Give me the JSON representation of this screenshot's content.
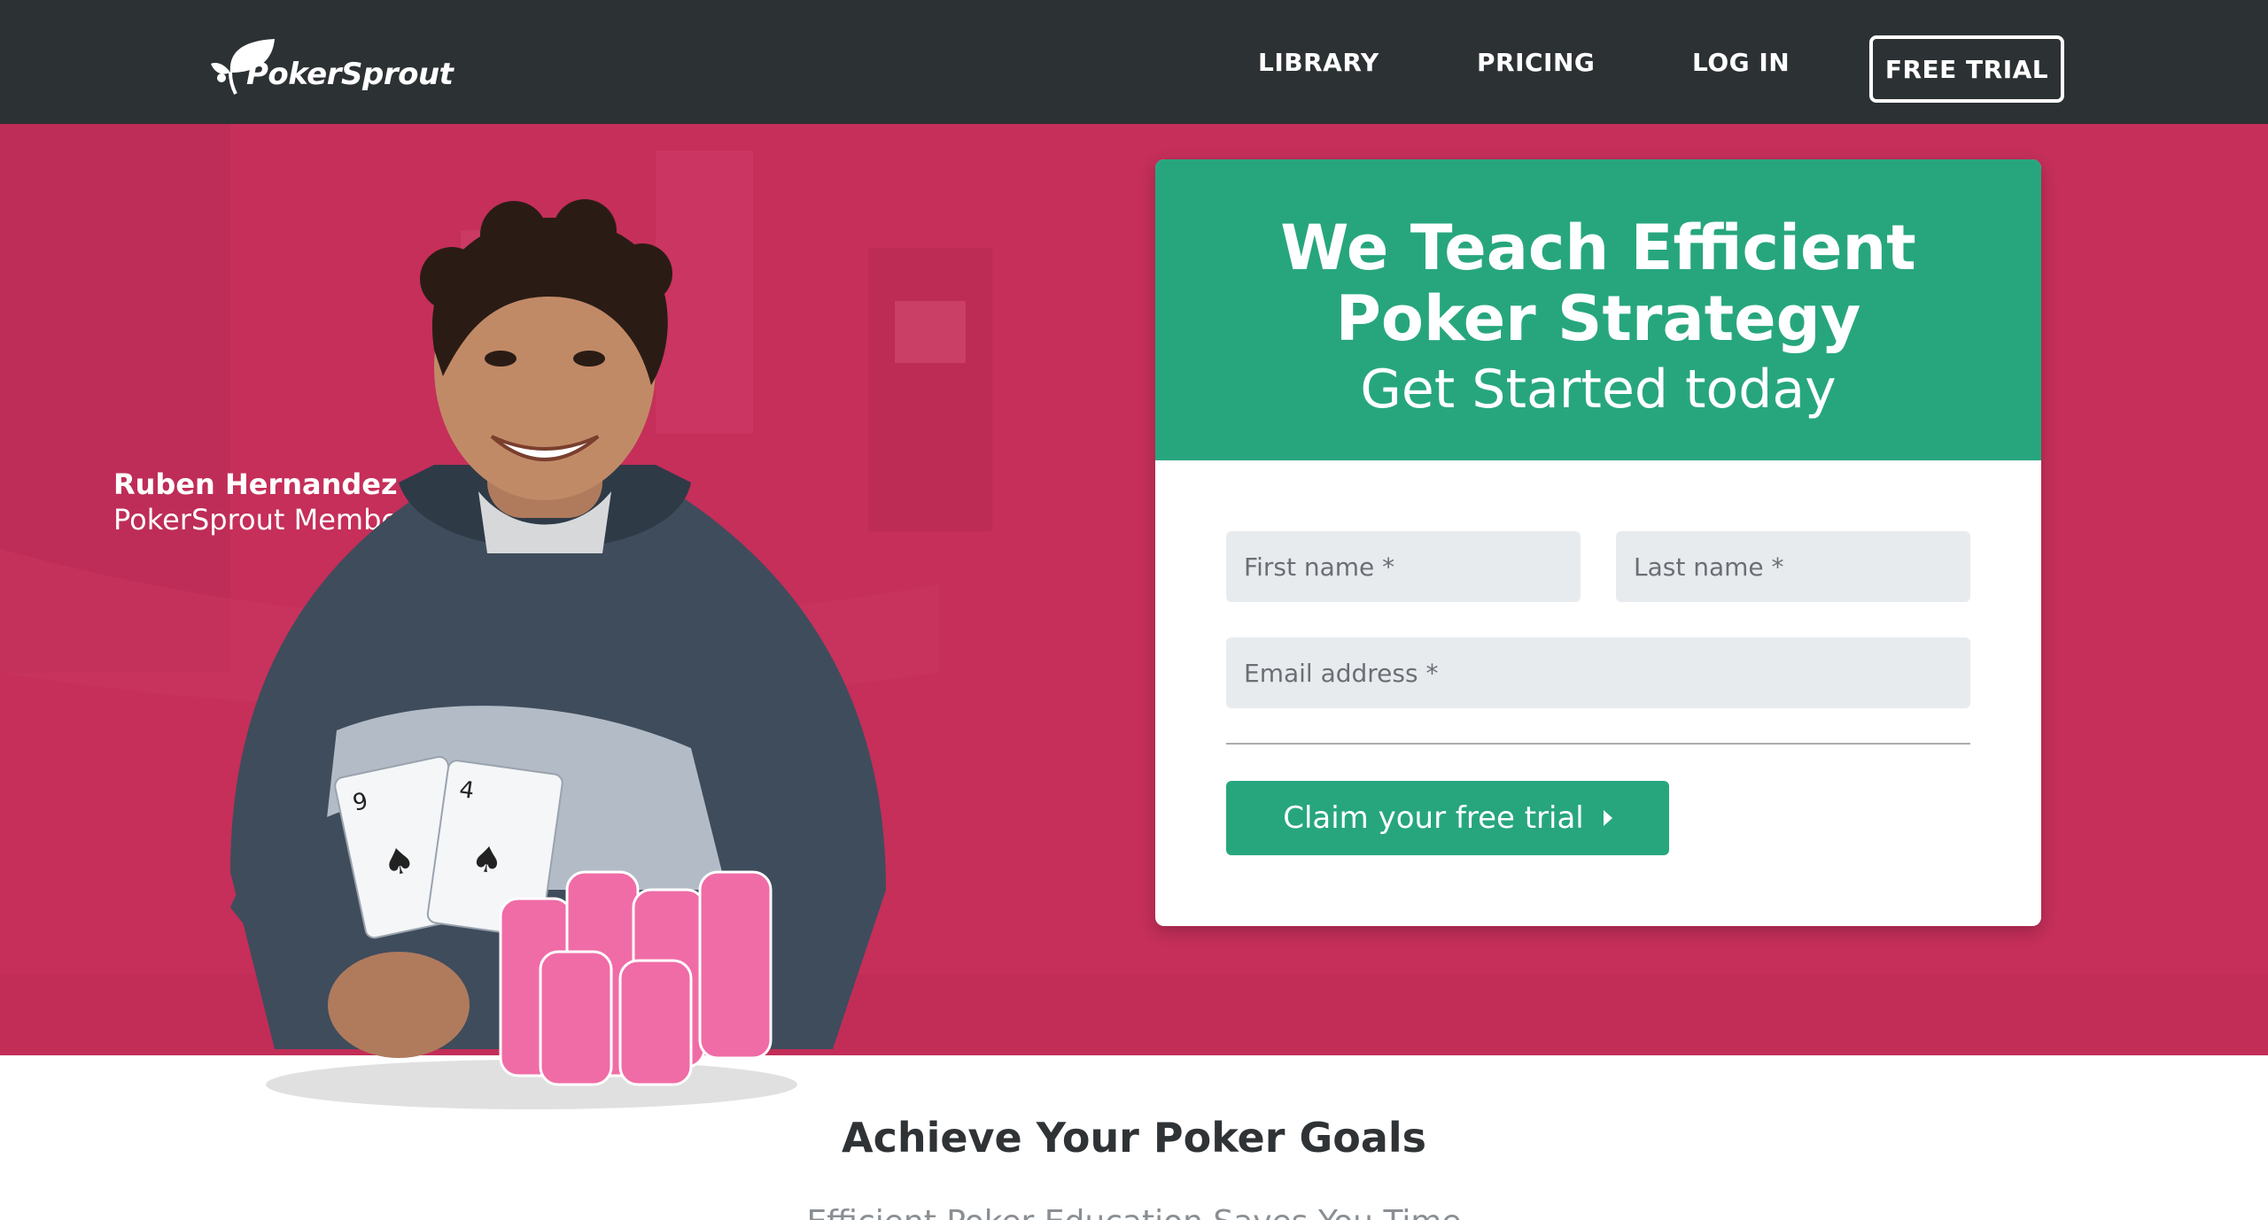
{
  "nav": {
    "logo_text": "PokerSprout",
    "links": [
      "LIBRARY",
      "PRICING",
      "LOG IN"
    ],
    "cta": "FREE TRIAL"
  },
  "hero": {
    "member_name": "Ruben Hernandez",
    "member_role": "PokerSprout Member",
    "background_color": "#c52f5a"
  },
  "card": {
    "title_line1": "We Teach Efficient",
    "title_line2": "Poker Strategy",
    "subtitle": "Get Started today",
    "header_color": "#27a67e",
    "first_name_placeholder": "First name *",
    "last_name_placeholder": "Last name *",
    "email_placeholder": "Email address *",
    "submit_label": "Claim your free trial"
  },
  "section": {
    "title": "Achieve Your Poker Goals",
    "subtitle": "Efficient Poker Education Saves You Time"
  }
}
